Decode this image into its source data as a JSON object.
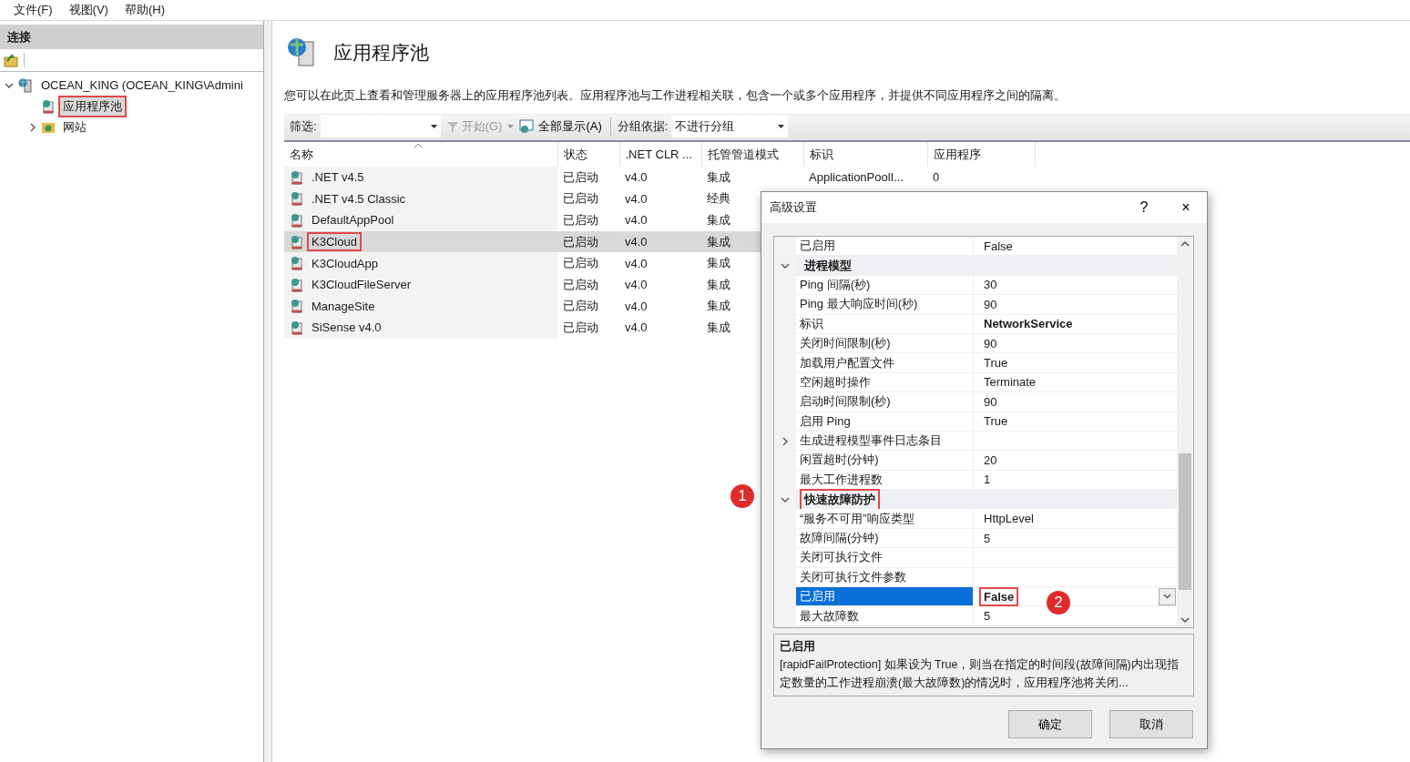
{
  "menu": [
    "文件(F)",
    "视图(V)",
    "帮助(H)"
  ],
  "connections": {
    "title": "连接",
    "tree": [
      {
        "label": "OCEAN_KING (OCEAN_KING\\Admini",
        "expanded": true,
        "selected": false,
        "highlighted": false,
        "children": [
          {
            "label": "应用程序池",
            "selected": true,
            "highlighted": true
          },
          {
            "label": "网站",
            "expanded": false,
            "selected": false,
            "highlighted": false
          }
        ]
      }
    ]
  },
  "page": {
    "title": "应用程序池",
    "description": "您可以在此页上查看和管理服务器上的应用程序池列表。应用程序池与工作进程相关联，包含一个或多个应用程序，并提供不同应用程序之间的隔离。"
  },
  "toolbar": {
    "filter_label": "筛选:",
    "start": {
      "label": "开始(G)",
      "disabled": true
    },
    "show_all": "全部显示(A)",
    "group_label": "分组依据:",
    "group_value": "不进行分组"
  },
  "table": {
    "columns": [
      "名称",
      "状态",
      ".NET CLR ...",
      "托管管道模式",
      "标识",
      "应用程序"
    ],
    "rows": [
      {
        "cells": [
          ".NET v4.5",
          "已启动",
          "v4.0",
          "集成",
          "ApplicationPoolI...",
          "0"
        ],
        "selected": false,
        "highlighted": false
      },
      {
        "cells": [
          ".NET v4.5 Classic",
          "已启动",
          "v4.0",
          "经典"
        ],
        "selected": false,
        "highlighted": false
      },
      {
        "cells": [
          "DefaultAppPool",
          "已启动",
          "v4.0",
          "集成"
        ],
        "selected": false,
        "highlighted": false
      },
      {
        "cells": [
          "K3Cloud",
          "已启动",
          "v4.0",
          "集成"
        ],
        "selected": true,
        "highlighted": true
      },
      {
        "cells": [
          "K3CloudApp",
          "已启动",
          "v4.0",
          "集成"
        ],
        "selected": false,
        "highlighted": false
      },
      {
        "cells": [
          "K3CloudFileServer",
          "已启动",
          "v4.0",
          "集成"
        ],
        "selected": false,
        "highlighted": false
      },
      {
        "cells": [
          "ManageSite",
          "已启动",
          "v4.0",
          "集成"
        ],
        "selected": false,
        "highlighted": false
      },
      {
        "cells": [
          "SiSense v4.0",
          "已启动",
          "v4.0",
          "集成"
        ],
        "selected": false,
        "highlighted": false
      }
    ]
  },
  "dialog": {
    "title": "高级设置",
    "help": "?",
    "close": "×",
    "properties": [
      {
        "kind": "prop",
        "name": "已启用",
        "value": "False",
        "selected": false,
        "modified": false,
        "highlighted": false
      },
      {
        "kind": "group",
        "name": "进程模型",
        "expanded": true,
        "highlighted": false
      },
      {
        "kind": "prop",
        "name": "Ping 间隔(秒)",
        "value": "30",
        "selected": false,
        "modified": false,
        "highlighted": false
      },
      {
        "kind": "prop",
        "name": "Ping 最大响应时间(秒)",
        "value": "90",
        "selected": false,
        "modified": false,
        "highlighted": false
      },
      {
        "kind": "prop",
        "name": "标识",
        "value": "NetworkService",
        "selected": false,
        "modified": true,
        "highlighted": false
      },
      {
        "kind": "prop",
        "name": "关闭时间限制(秒)",
        "value": "90",
        "selected": false,
        "modified": false,
        "highlighted": false
      },
      {
        "kind": "prop",
        "name": "加载用户配置文件",
        "value": "True",
        "selected": false,
        "modified": false,
        "highlighted": false
      },
      {
        "kind": "prop",
        "name": "空闲超时操作",
        "value": "Terminate",
        "selected": false,
        "modified": false,
        "highlighted": false
      },
      {
        "kind": "prop",
        "name": "启动时间限制(秒)",
        "value": "90",
        "selected": false,
        "modified": false,
        "highlighted": false
      },
      {
        "kind": "prop",
        "name": "启用 Ping",
        "value": "True",
        "selected": false,
        "modified": false,
        "highlighted": false
      },
      {
        "kind": "prop",
        "name": "生成进程模型事件日志条目",
        "expanded": false,
        "selected": false
      },
      {
        "kind": "prop",
        "name": "闲置超时(分钟)",
        "value": "20",
        "selected": false,
        "modified": false,
        "highlighted": false
      },
      {
        "kind": "prop",
        "name": "最大工作进程数",
        "value": "1",
        "selected": false,
        "modified": false,
        "highlighted": false
      },
      {
        "kind": "group",
        "name": "快速故障防护",
        "expanded": true,
        "highlighted": true
      },
      {
        "kind": "prop",
        "name": "“服务不可用”响应类型",
        "value": "HttpLevel",
        "selected": false,
        "modified": false,
        "highlighted": false
      },
      {
        "kind": "prop",
        "name": "故障间隔(分钟)",
        "value": "5",
        "selected": false,
        "modified": false,
        "highlighted": false
      },
      {
        "kind": "prop",
        "name": "关闭可执行文件",
        "selected": false
      },
      {
        "kind": "prop",
        "name": "关闭可执行文件参数",
        "selected": false
      },
      {
        "kind": "prop",
        "name": "已启用",
        "value": "False",
        "selected": true,
        "modified": true,
        "highlighted": true
      },
      {
        "kind": "prop",
        "name": "最大故障数",
        "value": "5",
        "selected": false,
        "modified": false,
        "highlighted": false
      }
    ],
    "help_title": "已启用",
    "help_text": "[rapidFailProtection] 如果设为 True，则当在指定的时间段(故障间隔)内出现指定数量的工作进程崩溃(最大故障数)的情况时，应用程序池将关闭...",
    "buttons": [
      "确定",
      "取消"
    ]
  },
  "callouts": [
    {
      "label": "1"
    },
    {
      "label": "2"
    }
  ]
}
